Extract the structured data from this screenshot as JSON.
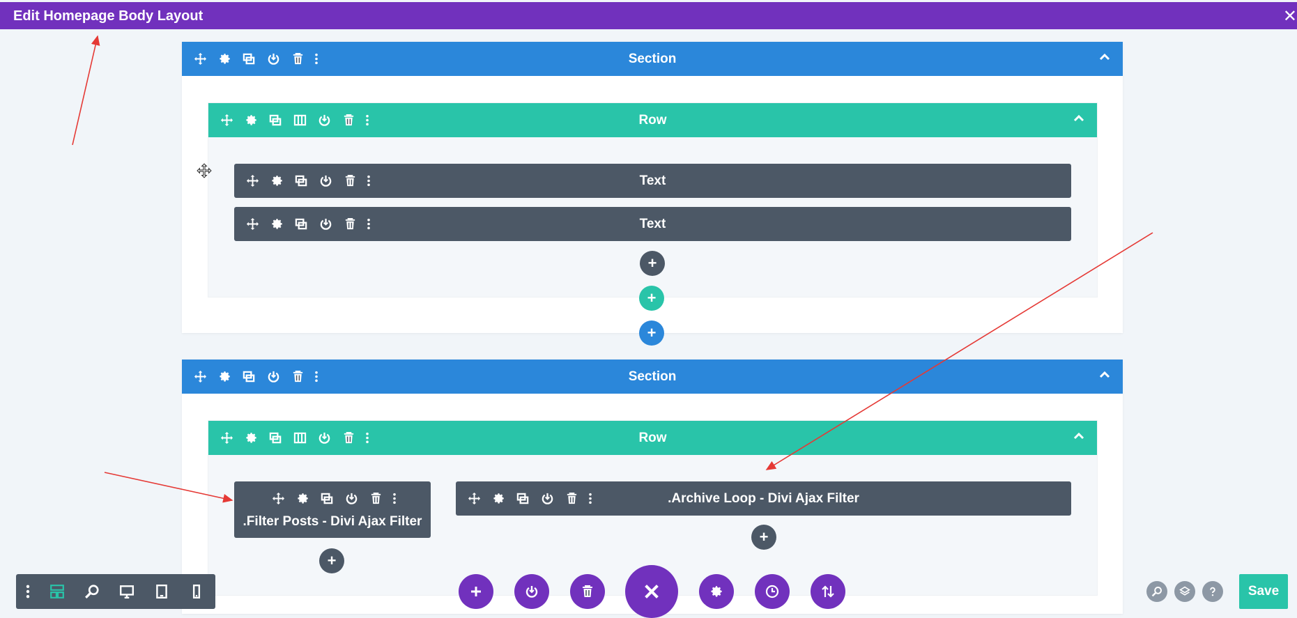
{
  "topbar": {
    "title": "Edit Homepage Body Layout",
    "close_glyph": "✕"
  },
  "section_label": "Section",
  "row_label": "Row",
  "modules": {
    "text1": "Text",
    "text2": "Text",
    "filter_posts": ".Filter Posts - Divi Ajax Filter",
    "archive_loop": ".Archive Loop - Divi Ajax Filter"
  },
  "plus_glyph": "+",
  "save_label": "Save",
  "colors": {
    "topbar": "#7131bd",
    "section": "#2b87da",
    "row": "#29c4a9",
    "module": "#4c5866",
    "save": "#29c4a9",
    "annotation": "#e53935"
  },
  "icons": [
    "move-icon",
    "gear-icon",
    "duplicate-icon",
    "columns-icon",
    "power-icon",
    "trash-icon",
    "more-icon",
    "chevron-up-icon",
    "search-icon",
    "layers-icon",
    "help-icon",
    "wireframe-icon",
    "desktop-icon",
    "tablet-icon",
    "phone-icon",
    "history-icon",
    "portability-icon",
    "close-icon"
  ]
}
